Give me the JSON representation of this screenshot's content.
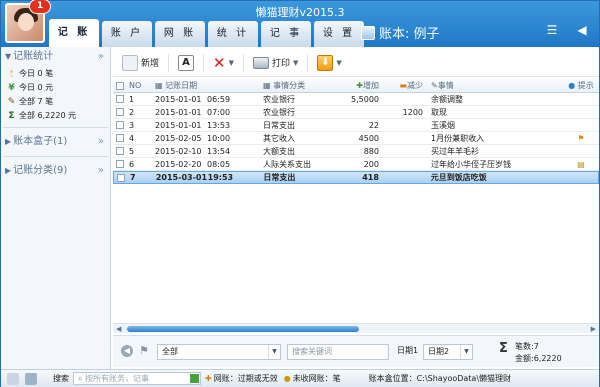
{
  "window": {
    "title": "懒猫理财v2015.3",
    "badge_count": "1"
  },
  "tabs": [
    "记 账",
    "账 户",
    "网 账",
    "统 计",
    "记 事",
    "设 置"
  ],
  "account_label": "账本: 例子",
  "sidebar": {
    "stats_title": "记账统计",
    "stats": [
      {
        "icon": "🕯",
        "label": "今日 0 笔"
      },
      {
        "icon": "¥",
        "label": "今日 0 元"
      },
      {
        "icon": "✎",
        "label": "全部 7 笔"
      },
      {
        "icon": "Σ",
        "label": "全部 6,2220 元"
      }
    ],
    "box_title": "账本盒子(1)",
    "cat_title": "记账分类(9)"
  },
  "toolbar": {
    "new": "新增",
    "print": "打印"
  },
  "columns": [
    "NO",
    "记账日期",
    "事情分类",
    "增加",
    "减少",
    "事情",
    "提示"
  ],
  "rows": [
    {
      "no": "1",
      "date": "2015-01-01",
      "time": "06:59",
      "cat": "农业银行",
      "inc": "5,5000",
      "dec": "",
      "desc": "余额调整",
      "hint": ""
    },
    {
      "no": "2",
      "date": "2015-01-01",
      "time": "07:00",
      "cat": "农业银行",
      "inc": "",
      "dec": "1200",
      "desc": "取现",
      "hint": ""
    },
    {
      "no": "3",
      "date": "2015-01-01",
      "time": "13:53",
      "cat": "日常支出",
      "inc": "22",
      "dec": "",
      "desc": "玉溪烟",
      "hint": ""
    },
    {
      "no": "4",
      "date": "2015-02-05",
      "time": "10:00",
      "cat": "其它收入",
      "inc": "4500",
      "dec": "",
      "desc": "1月份兼职收入",
      "hint": "flag"
    },
    {
      "no": "5",
      "date": "2015-02-10",
      "time": "13:54",
      "cat": "大额支出",
      "inc": "880",
      "dec": "",
      "desc": "买过年羊毛衫",
      "hint": ""
    },
    {
      "no": "6",
      "date": "2015-02-20",
      "time": "08:05",
      "cat": "人际关系支出",
      "inc": "200",
      "dec": "",
      "desc": "过年给小华侄子压岁钱",
      "hint": "note"
    },
    {
      "no": "7",
      "date": "2015-03-01",
      "time": "19:53",
      "cat": "日常支出",
      "inc": "418",
      "dec": "",
      "desc": "元旦到饭店吃饭",
      "hint": ""
    }
  ],
  "filter": {
    "scope": "全部",
    "keyword_placeholder": "搜索关键词",
    "date1": "日期1",
    "date2": "日期2",
    "count": "笔数:7",
    "total": "金额:6,2220"
  },
  "status": {
    "search_label": "搜索",
    "search_placeholder": "按所有账务，记事",
    "net": "网账：过期或无效",
    "unrecv": "未收网账：笔",
    "location": "账本盒位置：C:\\ShayooData\\懒猫理财"
  }
}
